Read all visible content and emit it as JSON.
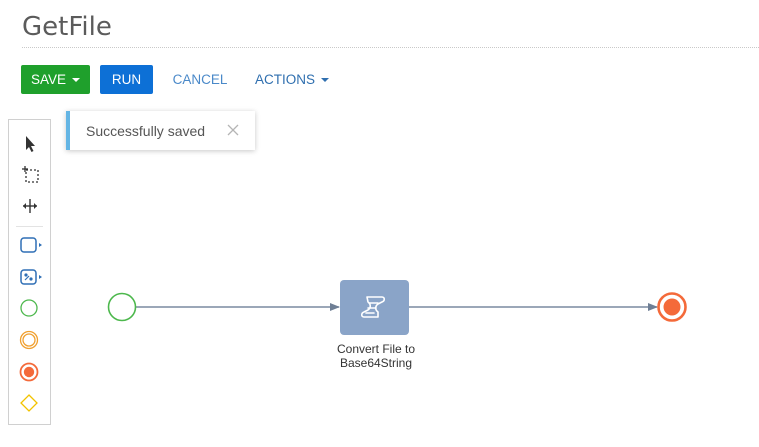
{
  "page": {
    "title": "GetFile"
  },
  "toolbar": {
    "save_label": "SAVE",
    "run_label": "RUN",
    "cancel_label": "CANCEL",
    "actions_label": "ACTIONS"
  },
  "toast": {
    "message": "Successfully saved"
  },
  "palette": {
    "items": [
      {
        "icon": "pointer-arrow-icon"
      },
      {
        "icon": "selection-marquee-icon"
      },
      {
        "icon": "pan-arrows-icon"
      },
      {
        "icon": "task-shape-icon"
      },
      {
        "icon": "subprocess-shape-icon"
      },
      {
        "icon": "start-event-icon"
      },
      {
        "icon": "intermediate-event-icon"
      },
      {
        "icon": "end-event-icon"
      },
      {
        "icon": "gateway-diamond-icon"
      }
    ]
  },
  "diagram": {
    "task": {
      "label_line1": "Convert File to",
      "label_line2": "Base64String"
    }
  },
  "colors": {
    "save": "#1fa02c",
    "run": "#0d70d6",
    "link": "#4a89c9",
    "start_event": "#4db84d",
    "intermediate_event": "#f0a030",
    "end_event": "#f46a3a",
    "task": "#8aa4c8",
    "gateway": "#f2c300",
    "toast_accent": "#64b5e4"
  }
}
